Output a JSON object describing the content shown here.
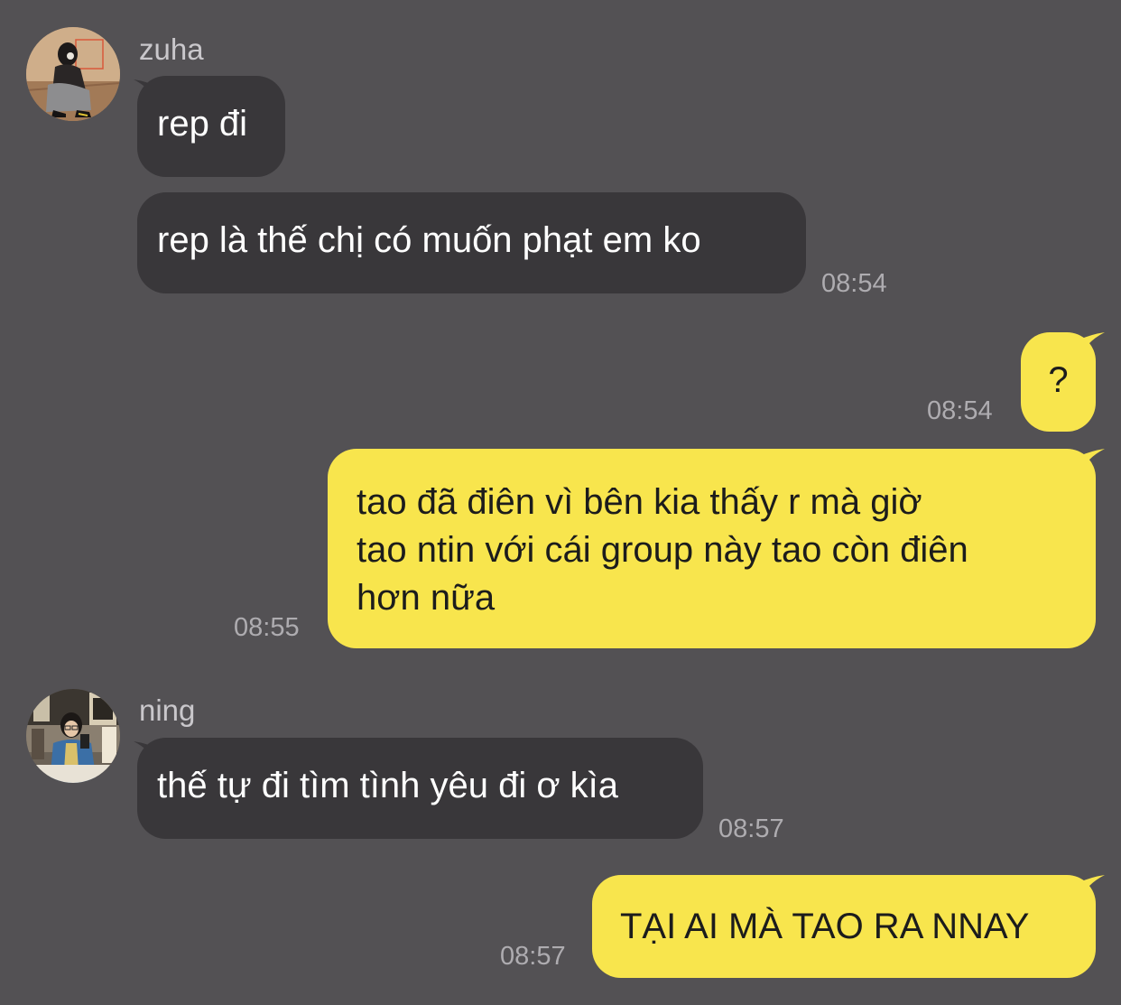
{
  "messages": [
    {
      "sender": "zuha",
      "direction": "incoming",
      "texts": [
        "rep đi",
        "rep là thế chị có muốn phạt em ko"
      ],
      "time": "08:54"
    },
    {
      "direction": "outgoing",
      "texts": [
        "?"
      ],
      "time": "08:54"
    },
    {
      "direction": "outgoing",
      "lines": [
        "tao đã điên vì bên kia thấy r mà giờ",
        "tao ntin với cái group này tao còn điên",
        "hơn nữa"
      ],
      "time": "08:55"
    },
    {
      "sender": "ning",
      "direction": "incoming",
      "texts": [
        "thế tự đi tìm tình yêu đi ơ kìa"
      ],
      "time": "08:57"
    },
    {
      "direction": "outgoing",
      "texts": [
        "TẠI AI MÀ TAO RA NNAY"
      ],
      "time": "08:57"
    }
  ],
  "colors": {
    "background": "#535154",
    "incoming_bubble": "#39373a",
    "outgoing_bubble": "#f8e54d",
    "incoming_text": "#ffffff",
    "outgoing_text": "#1c1c1c",
    "timestamp": "#aeacb0",
    "sender_name": "#c9c7cb"
  },
  "icons": {
    "avatar_zuha": "avatar-photo",
    "avatar_ning": "avatar-photo"
  }
}
